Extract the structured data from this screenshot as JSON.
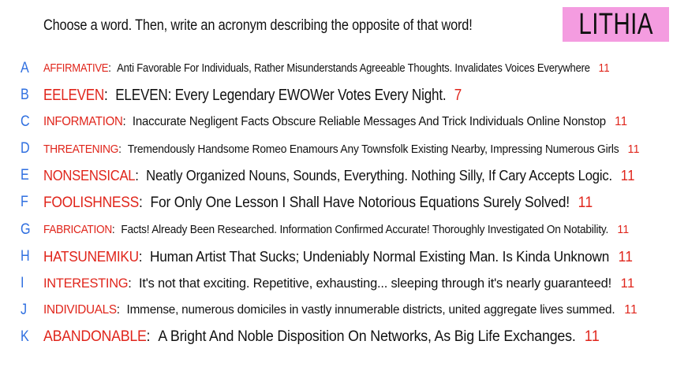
{
  "header": {
    "prompt": "Choose a word. Then, write an acronym describing the opposite of that word!",
    "badge_label": "LITHIA"
  },
  "colors": {
    "letter": "#2f6fe0",
    "word": "#e0251b",
    "score": "#e0251b",
    "badge_background": "#f49ce0",
    "text": "#111111"
  },
  "entries": [
    {
      "letter": "A",
      "word": "AFFIRMATIVE",
      "phrase": "Anti Favorable For Individuals, Rather Misunderstands Agreeable Thoughts. Invalidates Voices Everywhere",
      "score": "11"
    },
    {
      "letter": "B",
      "word": "EELEVEN",
      "phrase": "ELEVEN: Every Legendary EWOWer Votes Every Night.",
      "score": "7"
    },
    {
      "letter": "C",
      "word": "INFORMATION",
      "phrase": "Inaccurate Negligent Facts Obscure Reliable Messages And Trick Individuals Online Nonstop",
      "score": "11"
    },
    {
      "letter": "D",
      "word": "THREATENING",
      "phrase": "Tremendously Handsome Romeo Enamours Any Townsfolk Existing Nearby, Impressing Numerous Girls",
      "score": "11"
    },
    {
      "letter": "E",
      "word": "NONSENSICAL",
      "phrase": "Neatly Organized Nouns, Sounds, Everything. Nothing Silly, If Cary Accepts Logic.",
      "score": "11"
    },
    {
      "letter": "F",
      "word": "FOOLISHNESS",
      "phrase": "For Only One Lesson I Shall Have Notorious Equations Surely Solved!",
      "score": "11"
    },
    {
      "letter": "G",
      "word": "FABRICATION",
      "phrase": "Facts! Already Been Researched. Information Confirmed Accurate! Thoroughly Investigated On Notability.",
      "score": "11"
    },
    {
      "letter": "H",
      "word": "HATSUNEMIKU",
      "phrase": "Human Artist That Sucks; Undeniably Normal Existing Man. Is Kinda Unknown",
      "score": "11"
    },
    {
      "letter": "I",
      "word": "INTERESTING",
      "phrase": "It's not that exciting. Repetitive, exhausting... sleeping through it's nearly guaranteed!",
      "score": "11"
    },
    {
      "letter": "J",
      "word": "INDIVIDUALS",
      "phrase": "Immense, numerous domiciles in vastly innumerable districts, united aggregate lives summed.",
      "score": "11"
    },
    {
      "letter": "K",
      "word": "ABANDONABLE",
      "phrase": "A Bright And Noble Disposition On Networks, As Big Life Exchanges.",
      "score": "11"
    }
  ]
}
